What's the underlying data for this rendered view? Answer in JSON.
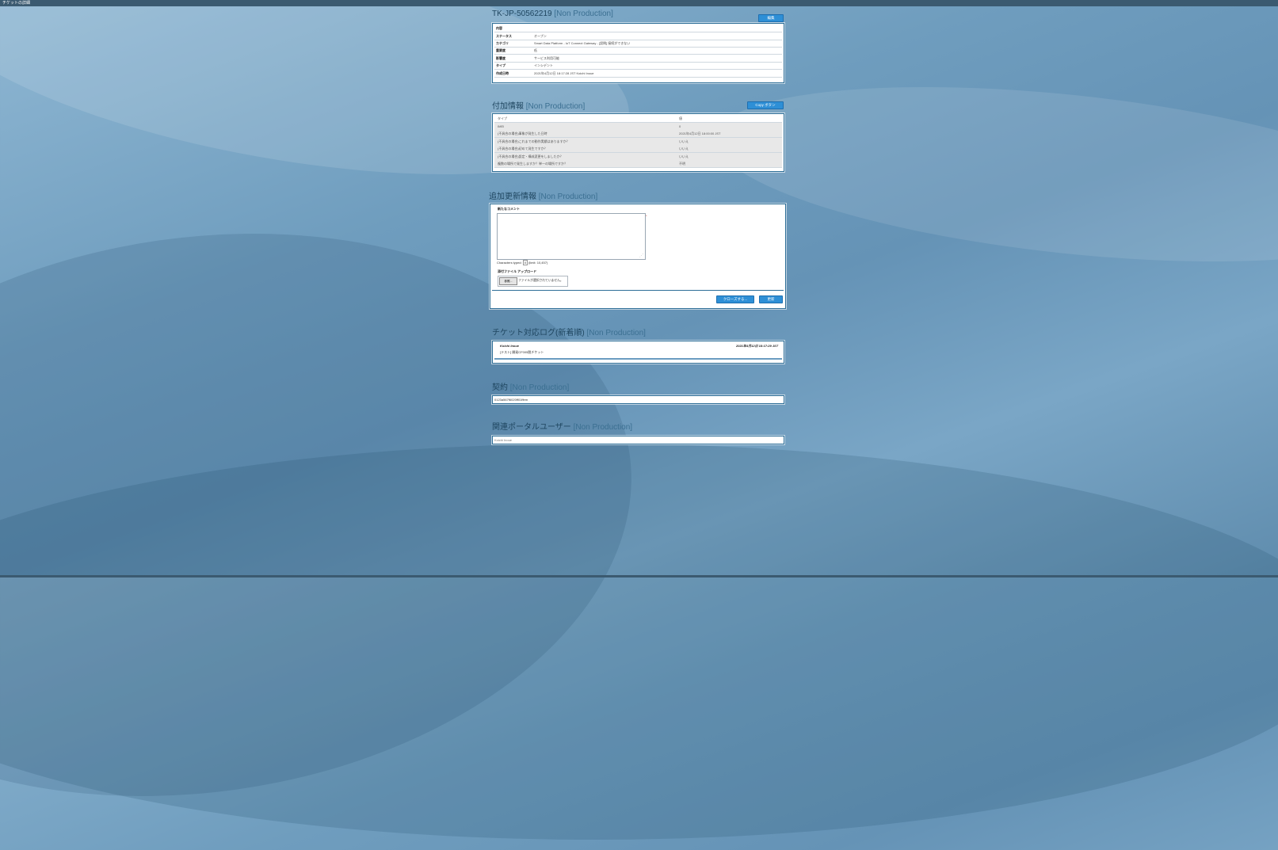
{
  "window": {
    "title": "チケットの詳細"
  },
  "ticket": {
    "title": "TK-JP-50562219",
    "env_tag": "[Non Production]",
    "edit_button": "編集",
    "header_label": "内容",
    "fields": [
      {
        "label": "ステータス",
        "value": "オープン"
      },
      {
        "label": "カテゴリ",
        "value": "Smart Data Platform - IoT Connect Gateway - [設問] 接続ができない"
      },
      {
        "label": "重要度",
        "value": "低"
      },
      {
        "label": "影響度",
        "value": "サービス利用可能"
      },
      {
        "label": "タイプ",
        "value": "インシデント"
      },
      {
        "label": "作成日時",
        "value": "2021年4月12日 18:17:28 JST Koichi Inoue"
      }
    ]
  },
  "additional": {
    "title": "付加情報",
    "env_tag": "[Non Production]",
    "copy_button": "Copy ボタン",
    "col_type": "タイプ",
    "col_value": "値",
    "rows": [
      {
        "type": "IMEI",
        "value": "0"
      },
      {
        "type": "(不具合の場合)事象が発生した日時",
        "value": "2021年4月12日 18:00:00 JST"
      },
      {
        "type": "(不具合の場合)これまでの動作実績はありますか？",
        "value": "いいえ"
      },
      {
        "type": "(不具合の場合)初めて発生ですか？",
        "value": "いいえ"
      },
      {
        "type": "(不具合の場合)設定・構成変更をしましたか？",
        "value": "いいえ"
      },
      {
        "type": "複数の場所で発生しますか？単一の場所ですか？",
        "value": "不明"
      }
    ]
  },
  "update": {
    "title": "追加更新情報",
    "env_tag": "[Non Production]",
    "comment_label": "新たなコメント",
    "required_mark": "*",
    "chars_typed_label": "Characters typed:",
    "chars_typed": "0",
    "limit": "(limit: 10,457)",
    "attach_label": "添付ファイル アップロード",
    "file_button": "参照...",
    "file_status": "ファイルが選択されていません。",
    "close_button": "クローズする...",
    "update_button": "更新"
  },
  "log": {
    "title": "チケット対応ログ(新着順)",
    "env_tag": "[Non Production]",
    "entries": [
      {
        "author": "Koichi Inoue",
        "time": "2021年4月12日 18:17:29 JST",
        "body": "[テスト] 開発CF005脱チケット"
      }
    ]
  },
  "contract": {
    "title": "契約",
    "env_tag": "[Non Production]",
    "value": "0123a567f6020ff01ffem"
  },
  "portal_user": {
    "title": "関連ポータルユーザー",
    "env_tag": "[Non Production]",
    "value": "Koichi Inoue"
  },
  "colors": {
    "accent": "#2e8fd6",
    "panel_border": "#2d6e97",
    "title": "#1f4660"
  }
}
